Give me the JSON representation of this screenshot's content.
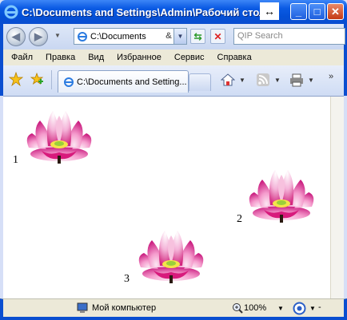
{
  "window": {
    "title": "C:\\Documents and Settings\\Admin\\Рабочий стол\\"
  },
  "navbar": {
    "address": "C:\\Documents",
    "search_placeholder": "QIP Search"
  },
  "menu": [
    "Файл",
    "Правка",
    "Вид",
    "Избранное",
    "Сервис",
    "Справка"
  ],
  "tab": {
    "label": "C:\\Documents and Setting..."
  },
  "content": {
    "images": [
      {
        "label": "1"
      },
      {
        "label": "2"
      },
      {
        "label": "3"
      }
    ]
  },
  "status": {
    "zone": "Мой компьютер",
    "zoom": "100%",
    "extra": "-"
  },
  "colors": {
    "titlebar": "#0a4ed0",
    "chrome": "#ece9d8",
    "lotus_pink": "#e0489a",
    "lotus_light": "#f8c4e0",
    "lotus_center": "#f4e44a"
  }
}
